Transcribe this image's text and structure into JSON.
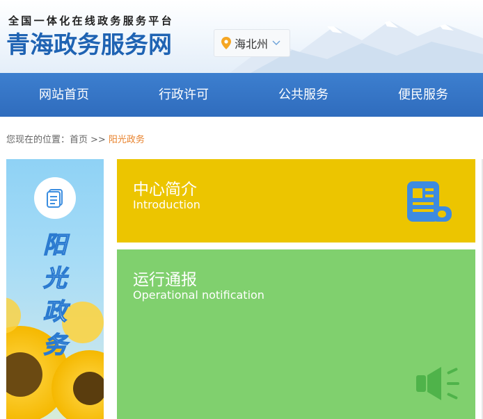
{
  "header": {
    "slogan": "全国一体化在线政务服务平台",
    "site_title": "青海政务服务网",
    "region": {
      "label": "海北州",
      "pin_icon": "location-pin-icon",
      "chevron_icon": "chevron-down-icon"
    }
  },
  "nav": {
    "items": [
      {
        "label": "网站首页"
      },
      {
        "label": "行政许可"
      },
      {
        "label": "公共服务"
      },
      {
        "label": "便民服务"
      }
    ]
  },
  "breadcrumb": {
    "prefix": "您现在的位置：",
    "home": "首页",
    "separator": ">>",
    "current": "阳光政务"
  },
  "side_banner": {
    "icon": "document-icon",
    "chars": [
      "阳",
      "光",
      "政",
      "务"
    ]
  },
  "cards": [
    {
      "title": "中心简介",
      "subtitle": "Introduction",
      "icon": "newspaper-icon",
      "color": "#ecc500"
    },
    {
      "title": "运行通报",
      "subtitle": "Operational notification",
      "icon": "speaker-icon",
      "color": "#80d06e"
    }
  ],
  "colors": {
    "brand_blue": "#1f63b3",
    "nav_blue": "#3474c5",
    "breadcrumb_current": "#e8812a"
  }
}
